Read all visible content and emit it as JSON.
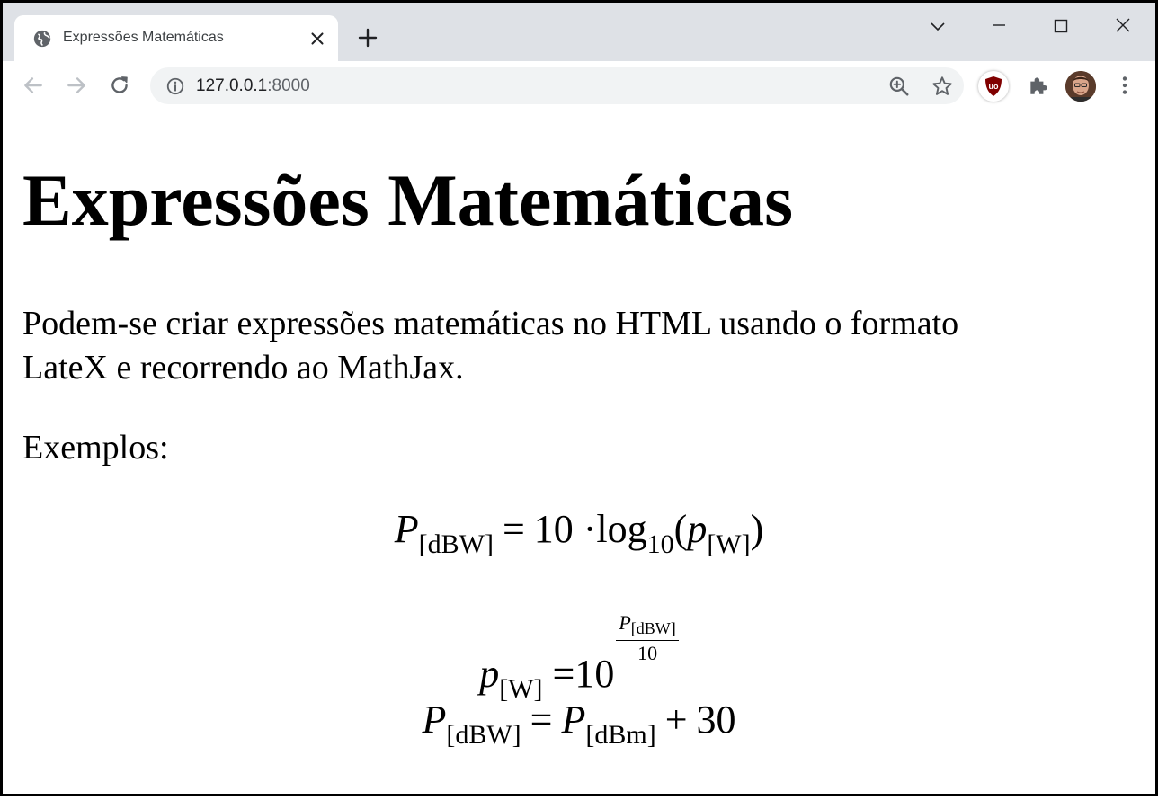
{
  "browser": {
    "tab_title": "Expressões Matemáticas",
    "url_host": "127.0.0.1",
    "url_port": ":8000"
  },
  "page": {
    "heading": "Expressões Matemáticas",
    "intro_line1": "Podem-se criar expressões matemáticas no HTML usando o formato",
    "intro_line2": "LateX e recorrendo ao MathJax.",
    "examples_label": "Exemplos:"
  },
  "equations": {
    "eq1": {
      "lhs_var": "P",
      "lhs_sub": "[dBW]",
      "eq": "=",
      "coef": "10",
      "dot": "·",
      "fn": "log",
      "fn_sub": "10",
      "open": "(",
      "arg_var": "p",
      "arg_sub": "[W]",
      "close": ")"
    },
    "eq2": {
      "lhs_var": "p",
      "lhs_sub": "[W]",
      "eq": "=",
      "base": "10",
      "exp_num_var": "P",
      "exp_num_sub": "[dBW]",
      "exp_den": "10"
    },
    "eq3": {
      "lhs_var": "P",
      "lhs_sub": "[dBW]",
      "eq": "=",
      "rhs_var": "P",
      "rhs_sub": "[dBm]",
      "plus": "+",
      "const": "30"
    }
  },
  "colors": {
    "tabstrip_bg": "#dee1e6",
    "omnibox_bg": "#f1f3f4",
    "icon_gray": "#5f6368",
    "ublock_red": "#800000"
  },
  "icons": {
    "favicon": "globe-icon",
    "tab_close": "close-icon",
    "new_tab": "plus-icon",
    "back": "arrow-left-icon",
    "forward": "arrow-right-icon",
    "reload": "reload-icon",
    "site_info": "info-icon",
    "zoom": "zoom-in-icon",
    "bookmark": "star-icon",
    "extension_ublock": "ublock-origin-icon",
    "extensions": "puzzle-icon",
    "profile": "avatar",
    "menu": "kebab-menu-icon"
  }
}
